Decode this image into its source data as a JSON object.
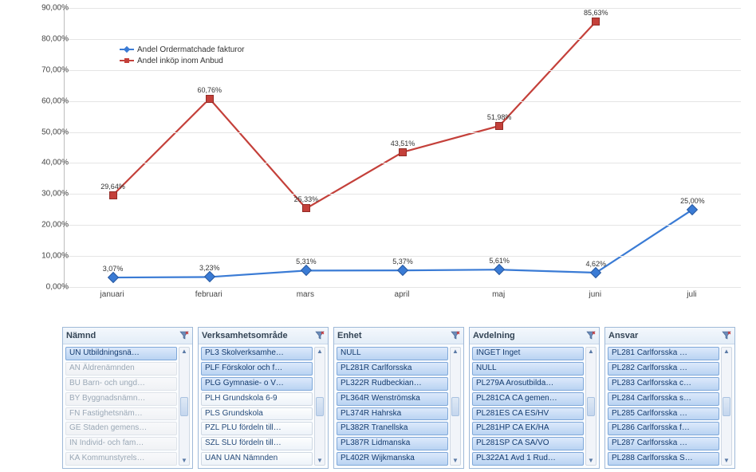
{
  "chart_data": {
    "type": "line",
    "categories": [
      "januari",
      "februari",
      "mars",
      "april",
      "maj",
      "juni",
      "juli"
    ],
    "series": [
      {
        "name": "Andel Ordermatchade fakturor",
        "color": "#3a7bd5",
        "marker": "diamond",
        "values": [
          3.07,
          3.23,
          5.31,
          5.37,
          5.61,
          4.62,
          25.0
        ]
      },
      {
        "name": "Andel inköp inom Anbud",
        "color": "#c4403a",
        "marker": "square",
        "values": [
          29.64,
          60.76,
          25.33,
          43.51,
          51.98,
          85.63,
          null
        ]
      }
    ],
    "ylabel": "",
    "xlabel": "",
    "ylim": [
      0,
      90
    ],
    "yticks": [
      0,
      10,
      20,
      30,
      40,
      50,
      60,
      70,
      80,
      90
    ],
    "yformat": "{v},00%",
    "data_labels": true
  },
  "legend": {
    "s0": "Andel Ordermatchade fakturor",
    "s1": "Andel inköp inom Anbud"
  },
  "slicers": [
    {
      "title": "Nämnd",
      "items": [
        {
          "label": "UN  Utbildningsnä…",
          "sel": true
        },
        {
          "label": "AN  Äldrenämnden",
          "dim": true
        },
        {
          "label": "BU  Barn- och ungd…",
          "dim": true
        },
        {
          "label": "BY  Byggnadsnämn…",
          "dim": true
        },
        {
          "label": "FN  Fastighetsnäm…",
          "dim": true
        },
        {
          "label": "GE  Staden gemens…",
          "dim": true
        },
        {
          "label": "IN  Individ- och fam…",
          "dim": true
        },
        {
          "label": "KA  Kommunstyrels…",
          "dim": true
        }
      ]
    },
    {
      "title": "Verksamhetsområde",
      "items": [
        {
          "label": "PL3  Skolverksamhe…",
          "sel": true
        },
        {
          "label": "PLF  Förskolor och f…",
          "sel": true
        },
        {
          "label": "PLG  Gymnasie- o V…",
          "sel": true
        },
        {
          "label": "PLH  Grundskola 6-9"
        },
        {
          "label": "PLS  Grundskola"
        },
        {
          "label": "PZL  PLU fördeln till…"
        },
        {
          "label": "SZL  SLU fördeln till…"
        },
        {
          "label": "UAN  UAN Nämnden"
        }
      ]
    },
    {
      "title": "Enhet",
      "items": [
        {
          "label": "NULL",
          "sel": true
        },
        {
          "label": "PL281R  Carlforsska",
          "sel": true
        },
        {
          "label": "PL322R  Rudbeckian…",
          "sel": true
        },
        {
          "label": "PL364R  Wenströmska",
          "sel": true
        },
        {
          "label": "PL374R  Hahrska",
          "sel": true
        },
        {
          "label": "PL382R  Tranellska",
          "sel": true
        },
        {
          "label": "PL387R  Lidmanska",
          "sel": true
        },
        {
          "label": "PL402R  Wijkmanska",
          "sel": true
        }
      ]
    },
    {
      "title": "Avdelning",
      "items": [
        {
          "label": "INGET  Inget",
          "sel": true
        },
        {
          "label": "NULL",
          "sel": true
        },
        {
          "label": "PL279A  Arosutbilda…",
          "sel": true
        },
        {
          "label": "PL281CA  CA gemen…",
          "sel": true
        },
        {
          "label": "PL281ES  CA ES/HV",
          "sel": true
        },
        {
          "label": "PL281HP  CA EK/HA",
          "sel": true
        },
        {
          "label": "PL281SP  CA SA/VO",
          "sel": true
        },
        {
          "label": "PL322A1  Avd 1 Rud…",
          "sel": true
        }
      ]
    },
    {
      "title": "Ansvar",
      "items": [
        {
          "label": "PL281  Carlforsska …",
          "sel": true
        },
        {
          "label": "PL282  Carlforsska …",
          "sel": true
        },
        {
          "label": "PL283  Carlforsska c…",
          "sel": true
        },
        {
          "label": "PL284  Carlforsska s…",
          "sel": true
        },
        {
          "label": "PL285  Carlforsska …",
          "sel": true
        },
        {
          "label": "PL286  Carlforsska f…",
          "sel": true
        },
        {
          "label": "PL287  Carlforsska …",
          "sel": true
        },
        {
          "label": "PL288  Carlforsska S…",
          "sel": true
        }
      ]
    }
  ]
}
